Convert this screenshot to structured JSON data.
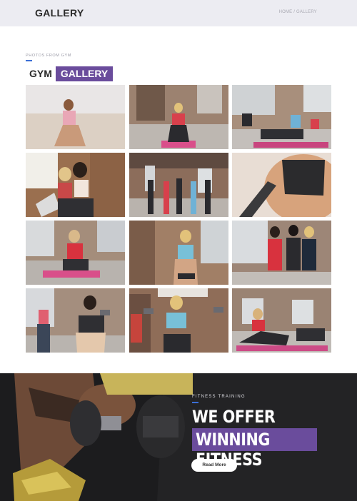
{
  "header": {
    "title": "GALLERY",
    "breadcrumb": {
      "home": "HOME",
      "separator": "/",
      "current": "GALLERY"
    }
  },
  "gallery": {
    "kicker": "PHOTOS FROM GYM",
    "heading_plain": "GYM",
    "heading_highlight": "GALLERY",
    "photos": [
      {
        "subject": "woman crouching on beach"
      },
      {
        "subject": "woman on yoga mat in brick gym"
      },
      {
        "subject": "group stretching in industrial gym"
      },
      {
        "subject": "two women with laptop"
      },
      {
        "subject": "group raising arms in gym"
      },
      {
        "subject": "closeup athletic top"
      },
      {
        "subject": "woman in red top on pink mat"
      },
      {
        "subject": "woman in blue sports bra"
      },
      {
        "subject": "three women posing"
      },
      {
        "subject": "women lifting dumbbells"
      },
      {
        "subject": "women with dumbbells in studio"
      },
      {
        "subject": "group on pink mats"
      }
    ]
  },
  "banner": {
    "kicker": "FITNESS TRAINING",
    "line1": "WE OFFER AWARD",
    "line2": "WINNING FITNESS",
    "button": "Read More"
  },
  "colors": {
    "accent_purple": "#6a4c9c",
    "accent_blue": "#3b6fd6",
    "header_bg": "#ececf2",
    "banner_bg": "#1d1d1f"
  }
}
